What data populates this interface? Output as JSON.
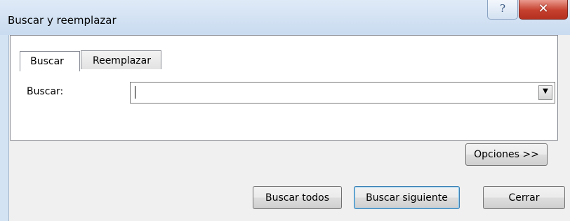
{
  "window": {
    "title": "Buscar y reemplazar",
    "help_glyph": "?",
    "close_glyph": "✕"
  },
  "tabs": [
    {
      "label": "Buscar",
      "selected": true
    },
    {
      "label": "Reemplazar",
      "selected": false
    }
  ],
  "find": {
    "label": "Buscar:",
    "value": "",
    "dropdown_glyph": "▼"
  },
  "buttons": {
    "options_label": "Opciones >>",
    "find_all_label": "Buscar todos",
    "find_next_label": "Buscar siguiente",
    "close_label": "Cerrar"
  },
  "colors": {
    "titlebar": "#c9dbf0",
    "close_button": "#c6402e",
    "default_button_border": "#3c7fb1"
  }
}
